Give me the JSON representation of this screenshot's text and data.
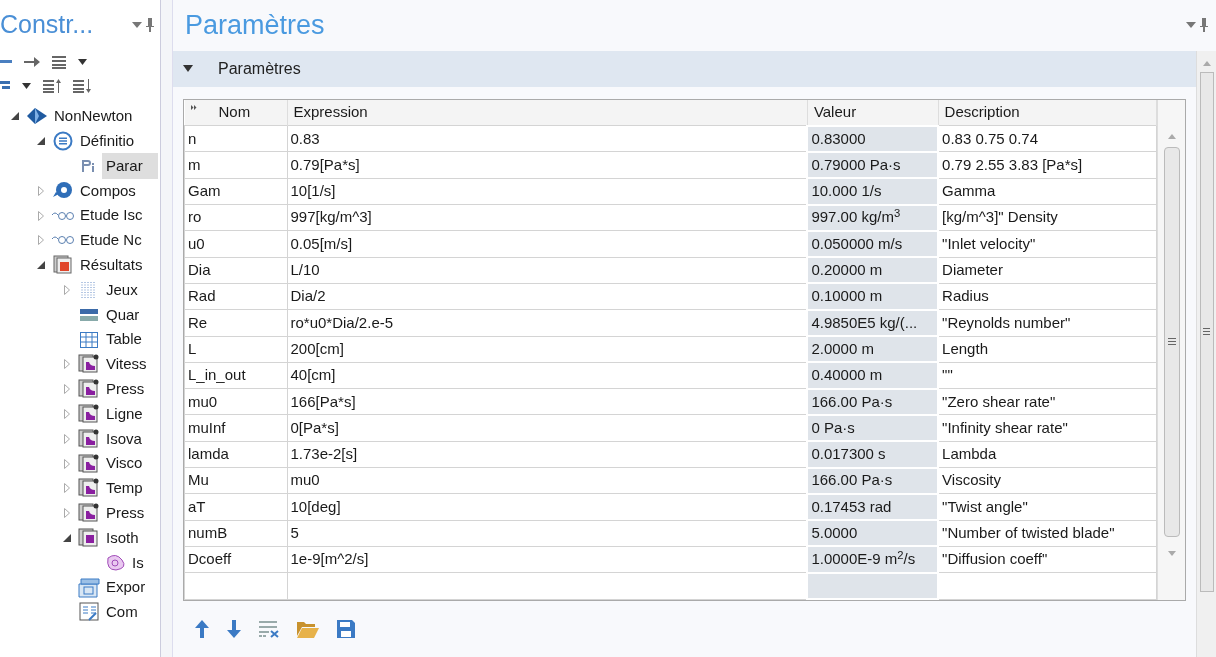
{
  "left_panel": {
    "title": "Constr...",
    "tree": [
      {
        "label": "NonNewton",
        "kind": "model",
        "expanded": true,
        "selected": false,
        "children": [
          {
            "label": "Définitio",
            "kind": "definitions",
            "expanded": true,
            "selected": false,
            "children": [
              {
                "label": "Parar",
                "kind": "param",
                "selected": true
              }
            ]
          },
          {
            "label": "Compos",
            "kind": "materials",
            "expanded": false,
            "selected": false
          },
          {
            "label": "Etude Isc",
            "kind": "study",
            "expanded": false,
            "selected": false
          },
          {
            "label": "Etude Nc",
            "kind": "study",
            "expanded": false,
            "selected": false
          },
          {
            "label": "Résultats",
            "kind": "results",
            "expanded": true,
            "selected": false,
            "children": [
              {
                "label": "Jeux",
                "kind": "dataset",
                "expanded": false,
                "selected": false
              },
              {
                "label": "Quar",
                "kind": "number",
                "selected": false
              },
              {
                "label": "Table",
                "kind": "table",
                "selected": false
              },
              {
                "label": "Vitess",
                "kind": "plot",
                "expanded": false,
                "selected": false
              },
              {
                "label": "Press",
                "kind": "plot",
                "expanded": false,
                "selected": false
              },
              {
                "label": "Ligne",
                "kind": "plot",
                "expanded": false,
                "selected": false
              },
              {
                "label": "Isova",
                "kind": "plot",
                "expanded": false,
                "selected": false
              },
              {
                "label": "Visco",
                "kind": "plot",
                "expanded": false,
                "selected": false
              },
              {
                "label": "Temp",
                "kind": "plot",
                "expanded": false,
                "selected": false
              },
              {
                "label": "Press",
                "kind": "plot",
                "expanded": false,
                "selected": false
              },
              {
                "label": "Isoth",
                "kind": "plot-group",
                "expanded": true,
                "selected": false,
                "children": [
                  {
                    "label": "Is",
                    "kind": "surface",
                    "selected": false
                  }
                ]
              },
              {
                "label": "Expor",
                "kind": "export",
                "selected": false
              },
              {
                "label": "Com",
                "kind": "report",
                "selected": false
              }
            ]
          }
        ]
      }
    ]
  },
  "settings": {
    "title": "Paramètres",
    "section": {
      "title": "Paramètres",
      "expanded": true
    },
    "table": {
      "columns": [
        "Nom",
        "Expression",
        "Valeur",
        "Description"
      ],
      "rows": [
        [
          "n",
          "0.83",
          "0.83000",
          "0.83 0.75 0.74"
        ],
        [
          "m",
          "0.79[Pa*s]",
          "0.79000 Pa·s",
          "0.79 2.55 3.83 [Pa*s]"
        ],
        [
          "Gam",
          "10[1/s]",
          "10.000 1/s",
          "Gamma"
        ],
        [
          "ro",
          "997[kg/m^3]",
          "997.00 kg/m$^{3}$",
          "[kg/m^3]\" Density"
        ],
        [
          "u0",
          "0.05[m/s]",
          "0.050000 m/s",
          "\"Inlet velocity\""
        ],
        [
          "Dia",
          "L/10",
          "0.20000 m",
          "Diameter"
        ],
        [
          "Rad",
          "Dia/2",
          "0.10000 m",
          "Radius"
        ],
        [
          "Re",
          "ro*u0*Dia/2.e-5",
          "4.9850E5 kg/(...",
          "\"Reynolds number\""
        ],
        [
          "L",
          "200[cm]",
          "2.0000 m",
          "Length"
        ],
        [
          "L_in_out",
          "40[cm]",
          "0.40000 m",
          "\"\""
        ],
        [
          "mu0",
          "166[Pa*s]",
          "166.00 Pa·s",
          "\"Zero shear rate\""
        ],
        [
          "muInf",
          "0[Pa*s]",
          "0 Pa·s",
          "\"Infinity shear rate\""
        ],
        [
          "lamda",
          "1.73e-2[s]",
          "0.017300 s",
          "Lambda"
        ],
        [
          "Mu",
          "mu0",
          "166.00 Pa·s",
          "Viscosity"
        ],
        [
          "aT",
          "10[deg]",
          "0.17453 rad",
          "\"Twist angle\""
        ],
        [
          "numB",
          "5",
          "5.0000",
          "\"Number of twisted blade\""
        ],
        [
          "Dcoeff",
          "1e-9[m^2/s]",
          "1.0000E-9 m$^{2}$/s",
          "\"Diffusion coeff\""
        ]
      ]
    }
  }
}
